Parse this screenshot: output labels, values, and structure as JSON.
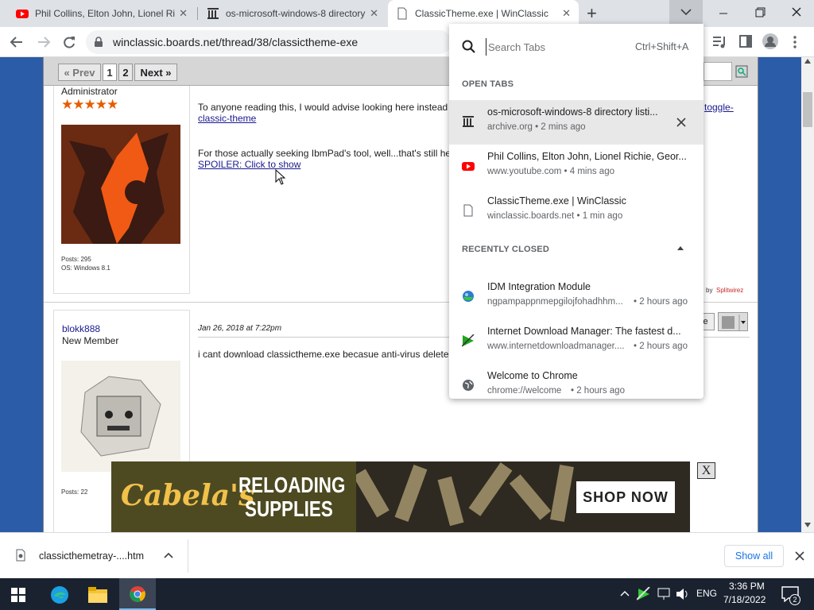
{
  "tabs": [
    {
      "title": "Phil Collins, Elton John, Lionel Richie, Geor",
      "close": "✕"
    },
    {
      "title": "os-microsoft-windows-8 directory listi",
      "close": "✕"
    },
    {
      "title": "ClassicTheme.exe | WinClassic",
      "close": "✕"
    }
  ],
  "new_tab": "+",
  "address": {
    "url": "winclassic.boards.net/thread/38/classictheme-exe"
  },
  "pager": {
    "prev": "« Prev",
    "page1": "1",
    "page2": "2",
    "next": "Next »"
  },
  "post1": {
    "role": "Administrator",
    "stars": "★★★★★",
    "posts": "Posts: 295",
    "os": "OS: Windows 8.1",
    "line1": "To anyone reading this, I would advise looking here instead",
    "link1_end": "toggle-",
    "link1b": "classic-theme",
    "line2": "For those actually seeking IbmPad's tool, well...that's still he",
    "spoiler": "SPOILER: Click to show",
    "mod_by": "by",
    "mod_user": "Splitwirez"
  },
  "post2": {
    "username": "blokk888",
    "rank": "New Member",
    "date": "Jan 26, 2018 at 7:22pm",
    "text": "i cant download classictheme.exe becasue anti-virus deletes",
    "posts": "Posts: 22",
    "quote_btn": "te"
  },
  "ad": {
    "brand": "Cabela's",
    "line1": "RELOADING",
    "line2": "SUPPLIES",
    "cta": "SHOP NOW",
    "close": "X"
  },
  "tab_search": {
    "placeholder": "Search Tabs",
    "shortcut": "Ctrl+Shift+A",
    "open_header": "OPEN TABS",
    "open_tabs": [
      {
        "title": "os-microsoft-windows-8 directory listi...",
        "sub": "archive.org • 2 mins ago",
        "icon": "archive-icon"
      },
      {
        "title": "Phil Collins, Elton John, Lionel Richie, Geor...",
        "sub": "www.youtube.com • 4 mins ago",
        "icon": "youtube-icon"
      },
      {
        "title": "ClassicTheme.exe | WinClassic",
        "sub": "winclassic.boards.net • 1 min ago",
        "icon": "page-icon"
      }
    ],
    "closed_header": "RECENTLY CLOSED",
    "closed_tabs": [
      {
        "title": "IDM Integration Module",
        "sub": "ngpampappnmepgilojfohadhhm...",
        "time": "• 2 hours ago",
        "icon": "idm-icon"
      },
      {
        "title": "Internet Download Manager: The fastest d...",
        "sub": "www.internetdownloadmanager....",
        "time": "• 2 hours ago",
        "icon": "idm-play-icon"
      },
      {
        "title": "Welcome to Chrome",
        "sub": "chrome://welcome",
        "time": "• 2 hours ago",
        "icon": "globe-icon"
      }
    ]
  },
  "download": {
    "filename": "classicthemetray-....htm",
    "show_all": "Show all"
  },
  "taskbar": {
    "lang": "ENG",
    "time": "3:36 PM",
    "date": "7/18/2022",
    "notif_count": "2"
  },
  "colors": {
    "accent": "#1a73e8",
    "page_bg": "#2b5ca8",
    "taskbar": "#1a2230"
  }
}
